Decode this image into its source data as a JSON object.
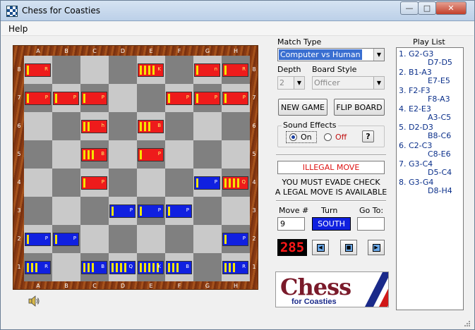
{
  "window": {
    "title": "Chess for Coasties"
  },
  "menu": {
    "help": "Help"
  },
  "board": {
    "files": [
      "A",
      "B",
      "C",
      "D",
      "E",
      "F",
      "G",
      "H"
    ],
    "ranks": [
      "8",
      "7",
      "6",
      "5",
      "4",
      "3",
      "2",
      "1"
    ],
    "pieces": [
      {
        "square": "A8",
        "color": "red",
        "label": "R",
        "stripes": 1
      },
      {
        "square": "E8",
        "color": "red",
        "label": "K",
        "stripes": 4
      },
      {
        "square": "G8",
        "color": "red",
        "label": "n",
        "stripes": 1
      },
      {
        "square": "H8",
        "color": "red",
        "label": "R",
        "stripes": 1
      },
      {
        "square": "A7",
        "color": "red",
        "label": "P",
        "stripes": 1
      },
      {
        "square": "B7",
        "color": "red",
        "label": "P",
        "stripes": 1
      },
      {
        "square": "C7",
        "color": "red",
        "label": "P",
        "stripes": 1
      },
      {
        "square": "F7",
        "color": "red",
        "label": "P",
        "stripes": 1
      },
      {
        "square": "G7",
        "color": "red",
        "label": "P",
        "stripes": 1
      },
      {
        "square": "H7",
        "color": "red",
        "label": "P",
        "stripes": 1
      },
      {
        "square": "C6",
        "color": "red",
        "label": "h",
        "stripes": 2
      },
      {
        "square": "E6",
        "color": "red",
        "label": "B",
        "stripes": 3
      },
      {
        "square": "C5",
        "color": "red",
        "label": "B",
        "stripes": 3
      },
      {
        "square": "E5",
        "color": "red",
        "label": "P",
        "stripes": 1
      },
      {
        "square": "C4",
        "color": "red",
        "label": "P",
        "stripes": 1
      },
      {
        "square": "G4",
        "color": "blue",
        "label": "P",
        "stripes": 1
      },
      {
        "square": "H4",
        "color": "red",
        "label": "Q",
        "stripes": 4
      },
      {
        "square": "D3",
        "color": "blue",
        "label": "P",
        "stripes": 1
      },
      {
        "square": "E3",
        "color": "blue",
        "label": "P",
        "stripes": 1
      },
      {
        "square": "F3",
        "color": "blue",
        "label": "P",
        "stripes": 1
      },
      {
        "square": "A2",
        "color": "blue",
        "label": "P",
        "stripes": 1
      },
      {
        "square": "B2",
        "color": "blue",
        "label": "P",
        "stripes": 1
      },
      {
        "square": "H2",
        "color": "blue",
        "label": "P",
        "stripes": 1
      },
      {
        "square": "A1",
        "color": "blue",
        "label": "R",
        "stripes": 3
      },
      {
        "square": "C1",
        "color": "blue",
        "label": "B",
        "stripes": 3
      },
      {
        "square": "D1",
        "color": "blue",
        "label": "Q",
        "stripes": 4
      },
      {
        "square": "E1",
        "color": "blue",
        "label": "K",
        "stripes": 5
      },
      {
        "square": "F1",
        "color": "blue",
        "label": "B",
        "stripes": 3
      },
      {
        "square": "H1",
        "color": "blue",
        "label": "R",
        "stripes": 3
      }
    ]
  },
  "controls": {
    "match_type_label": "Match Type",
    "match_type_value": "Computer vs Human",
    "depth_label": "Depth",
    "depth_value": "2",
    "board_style_label": "Board Style",
    "board_style_value": "Officer",
    "new_game": "NEW GAME",
    "flip_board": "FLIP BOARD",
    "sound_effects_label": "Sound Effects",
    "sound_on": "On",
    "sound_off": "Off",
    "help_button": "?",
    "status_message": "ILLEGAL MOVE",
    "info_line1": "YOU MUST EVADE CHECK",
    "info_line2": "A LEGAL MOVE IS AVAILABLE",
    "move_label": "Move #",
    "move_value": "9",
    "turn_label": "Turn",
    "turn_value": "SOUTH",
    "goto_label": "Go To:",
    "goto_value": "",
    "led_value": "285"
  },
  "logo": {
    "main": "Chess",
    "sub": "for Coasties"
  },
  "playlist": {
    "title": "Play List",
    "moves": [
      {
        "white": "1. G2-G3",
        "black": "D7-D5"
      },
      {
        "white": "2. B1-A3",
        "black": "E7-E5"
      },
      {
        "white": "3. F2-F3",
        "black": "F8-A3"
      },
      {
        "white": "4. E2-E3",
        "black": "A3-C5"
      },
      {
        "white": "5. D2-D3",
        "black": "B8-C6"
      },
      {
        "white": "6. C2-C3",
        "black": "C8-E6"
      },
      {
        "white": "7. G3-C4",
        "black": "D5-C4"
      },
      {
        "white": "8. G3-G4",
        "black": "D8-H4"
      }
    ]
  },
  "colors": {
    "red_piece": "#ee1b1b",
    "blue_piece": "#1020e0",
    "stripe": "#f5e400",
    "led": "#ff1818"
  }
}
